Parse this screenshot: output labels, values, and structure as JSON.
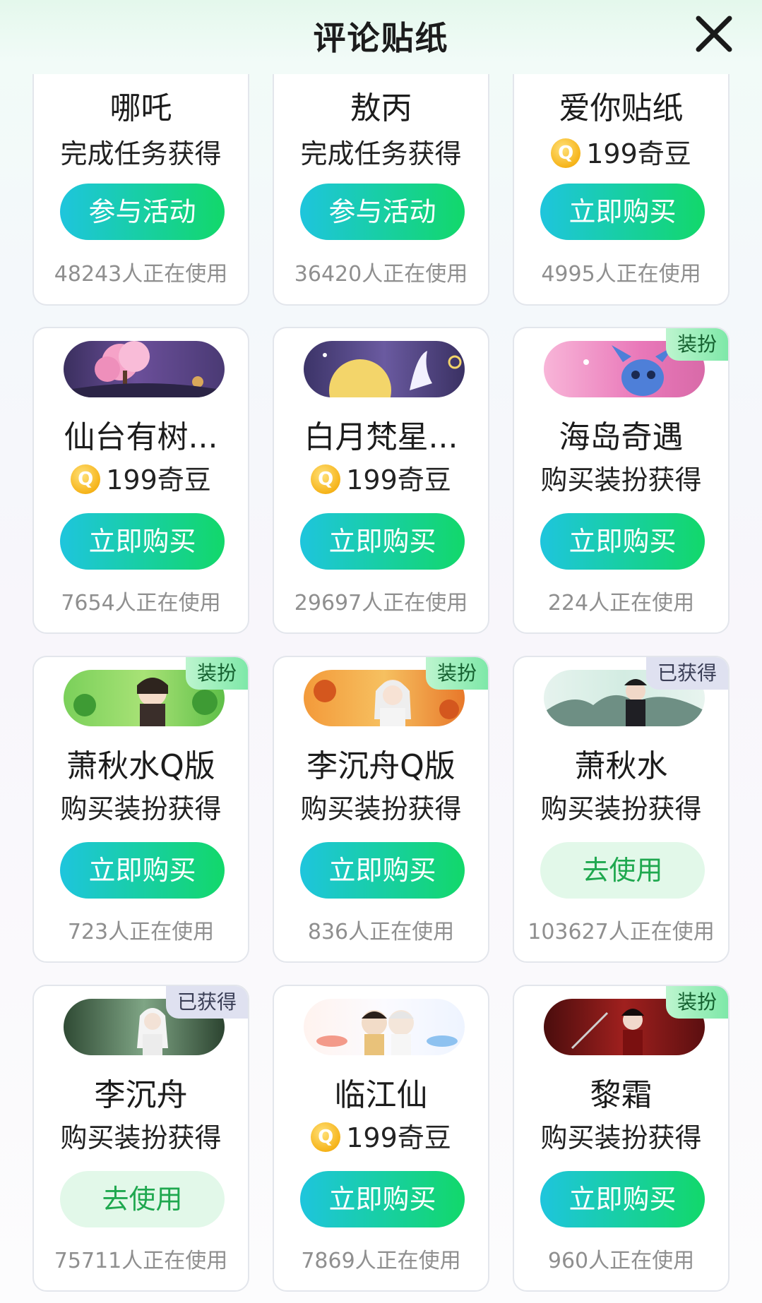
{
  "header": {
    "title": "评论贴纸"
  },
  "cards": [
    {
      "name": "哪吒",
      "sub": "完成任务获得",
      "coin": false,
      "button": "参与活动",
      "count": "48243人正在使用",
      "tag": ""
    },
    {
      "name": "敖丙",
      "sub": "完成任务获得",
      "coin": false,
      "button": "参与活动",
      "count": "36420人正在使用",
      "tag": ""
    },
    {
      "name": "爱你贴纸",
      "sub": "199奇豆",
      "coin": true,
      "button": "立即购买",
      "count": "4995人正在使用",
      "tag": ""
    },
    {
      "name": "仙台有树...",
      "sub": "199奇豆",
      "coin": true,
      "button": "立即购买",
      "count": "7654人正在使用",
      "tag": ""
    },
    {
      "name": "白月梵星...",
      "sub": "199奇豆",
      "coin": true,
      "button": "立即购买",
      "count": "29697人正在使用",
      "tag": ""
    },
    {
      "name": "海岛奇遇",
      "sub": "购买装扮获得",
      "coin": false,
      "button": "立即购买",
      "count": "224人正在使用",
      "tag": "装扮"
    },
    {
      "name": "萧秋水Q版",
      "sub": "购买装扮获得",
      "coin": false,
      "button": "立即购买",
      "count": "723人正在使用",
      "tag": "装扮"
    },
    {
      "name": "李沉舟Q版",
      "sub": "购买装扮获得",
      "coin": false,
      "button": "立即购买",
      "count": "836人正在使用",
      "tag": "装扮"
    },
    {
      "name": "萧秋水",
      "sub": "购买装扮获得",
      "coin": false,
      "button": "去使用",
      "count": "103627人正在使用",
      "tag": "已获得"
    },
    {
      "name": "李沉舟",
      "sub": "购买装扮获得",
      "coin": false,
      "button": "去使用",
      "count": "75711人正在使用",
      "tag": "已获得"
    },
    {
      "name": "临江仙",
      "sub": "199奇豆",
      "coin": true,
      "button": "立即购买",
      "count": "7869人正在使用",
      "tag": ""
    },
    {
      "name": "黎霜",
      "sub": "购买装扮获得",
      "coin": false,
      "button": "立即购买",
      "count": "960人正在使用",
      "tag": "装扮"
    }
  ],
  "colors": {
    "accent_start": "#1ec5dd",
    "accent_end": "#12d86a",
    "use_bg": "#e2f8e9",
    "use_text": "#1fa84f"
  }
}
